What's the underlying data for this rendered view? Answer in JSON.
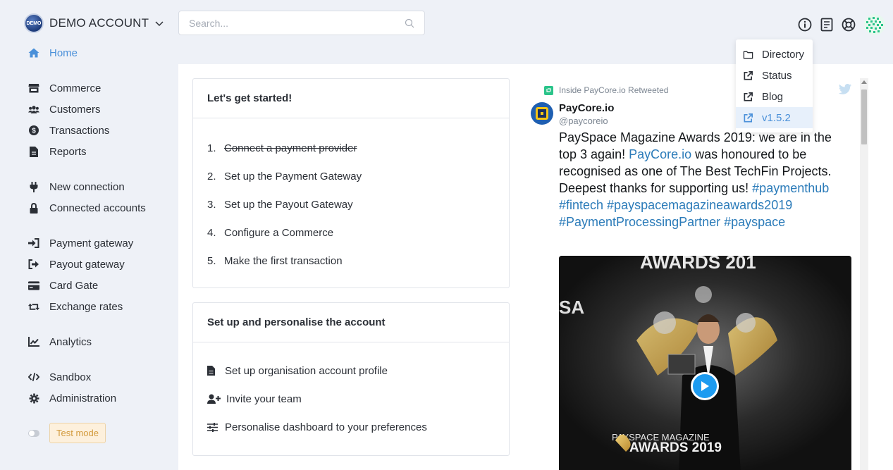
{
  "account": {
    "name": "DEMO ACCOUNT",
    "logo_text": "DEMO"
  },
  "search": {
    "placeholder": "Search..."
  },
  "help_menu": {
    "items": [
      {
        "label": "Directory",
        "icon": "folder-icon"
      },
      {
        "label": "Status",
        "icon": "external-link-icon"
      },
      {
        "label": "Blog",
        "icon": "external-link-icon"
      },
      {
        "label": "v1.5.2",
        "icon": "external-link-icon",
        "active": true
      }
    ]
  },
  "sidebar": {
    "home": "Home",
    "commerce": "Commerce",
    "customers": "Customers",
    "transactions": "Transactions",
    "reports": "Reports",
    "new_connection": "New connection",
    "connected_accounts": "Connected accounts",
    "payment_gateway": "Payment gateway",
    "payout_gateway": "Payout gateway",
    "card_gate": "Card Gate",
    "exchange_rates": "Exchange rates",
    "analytics": "Analytics",
    "sandbox": "Sandbox",
    "administration": "Administration",
    "test_mode": "Test mode"
  },
  "getting_started": {
    "title": "Let's get started!",
    "steps": [
      {
        "num": "1.",
        "text": "Connect a payment provider",
        "done": true
      },
      {
        "num": "2.",
        "text": "Set up the Payment Gateway",
        "done": false
      },
      {
        "num": "3.",
        "text": "Set up the Payout Gateway",
        "done": false
      },
      {
        "num": "4.",
        "text": "Configure a Commerce",
        "done": false
      },
      {
        "num": "5.",
        "text": "Make the first transaction",
        "done": false
      }
    ]
  },
  "personalise": {
    "title": "Set up and personalise the account",
    "items": [
      {
        "text": "Set up organisation account profile",
        "icon": "file-icon"
      },
      {
        "text": "Invite your team",
        "icon": "user-plus-icon"
      },
      {
        "text": "Personalise dashboard to your preferences",
        "icon": "sliders-icon"
      }
    ]
  },
  "tweet": {
    "retweet_text": "Inside PayCore.io Retweeted",
    "author_name": "PayCore.io",
    "author_handle": "@paycoreio",
    "text_1": "PaySpace Magazine Awards 2019: we are in the top 3 again! ",
    "link_1": "PayCore.io",
    "text_2": " was honoured to be recognised as one of The Best TechFin Projects. Deepest thanks for supporting us! ",
    "hashtags_1": "#paymenthub #fintech #payspacemagazineawards2019 #PaymentProcessingPartner #payspace",
    "media_top_text": "AWARDS 201",
    "media_side_text": "SA",
    "media_bottom_small": "PAYSPACE MAGAZINE",
    "media_bottom_big": "AWARDS 2019"
  },
  "colors": {
    "accent": "#4a90d9",
    "badge_bg": "#fdf0dc",
    "twitter": "#1d9bf0"
  }
}
